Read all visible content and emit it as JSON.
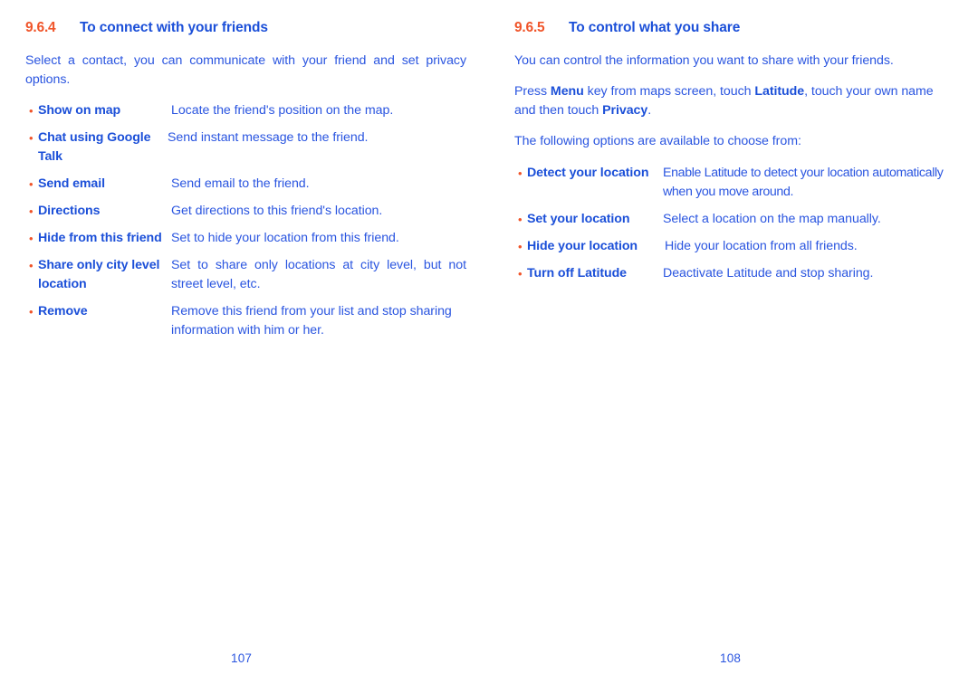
{
  "document": {
    "type": "user-manual-spread",
    "text_color": "#2A55E0",
    "heading_color": "#1B4FD8",
    "accent_color": "#F0552A",
    "bullet_glyph": "•"
  },
  "left_page": {
    "heading": {
      "number": "9.6.4",
      "title": "To connect with your friends"
    },
    "intro": "Select a contact, you can communicate with your friend and set privacy options.",
    "items": [
      {
        "term": "Show on map",
        "desc": "Locate the friend's position on the map."
      },
      {
        "term": "Chat using Google Talk",
        "desc": "Send instant message to the friend."
      },
      {
        "term": "Send email",
        "desc": "Send email to the friend."
      },
      {
        "term": "Directions",
        "desc": "Get directions to this friend's location."
      },
      {
        "term": "Hide from this friend",
        "desc": "Set to hide your location from this friend."
      },
      {
        "term": "Share only city level location",
        "desc": "Set to share only locations at city level, but not street level, etc."
      },
      {
        "term": "Remove",
        "desc": "Remove this friend from your list and stop sharing information with him or her."
      }
    ],
    "folio": "107"
  },
  "right_page": {
    "heading": {
      "number": "9.6.5",
      "title": "To control what you share"
    },
    "intro": "You can control the information you want to share with your friends.",
    "instruction_parts": {
      "p1": "Press ",
      "b1": "Menu",
      "p2": " key from maps screen, touch ",
      "b2": "Latitude",
      "p3": ", touch your own name and then touch ",
      "b3": "Privacy",
      "p4": "."
    },
    "options_lead": "The following options are available to choose from:",
    "items": [
      {
        "term": "Detect your location",
        "desc": "Enable Latitude to detect your location automatically when you move around."
      },
      {
        "term": "Set your location",
        "desc": "Select a location on the map manually."
      },
      {
        "term": "Hide your location",
        "desc": "Hide your location from all friends."
      },
      {
        "term": "Turn off Latitude",
        "desc": "Deactivate Latitude and stop sharing."
      }
    ],
    "folio": "108"
  }
}
